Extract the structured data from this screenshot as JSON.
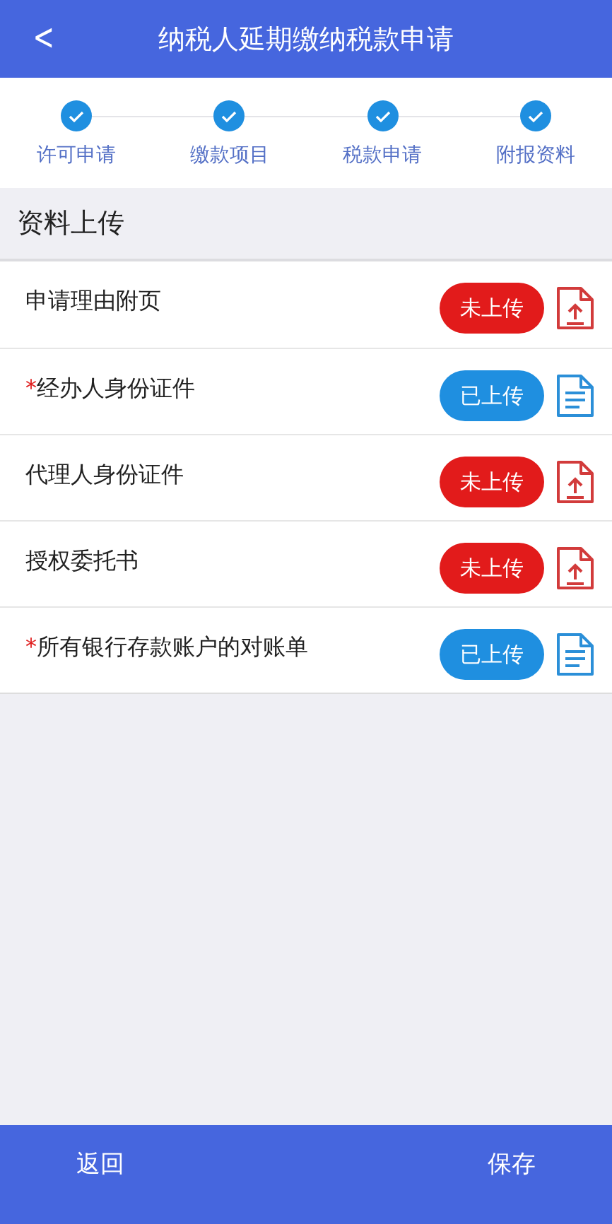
{
  "header": {
    "back": "<",
    "title": "纳税人延期缴纳税款申请"
  },
  "steps": [
    {
      "label": "许可申请",
      "done": true
    },
    {
      "label": "缴款项目",
      "done": true
    },
    {
      "label": "税款申请",
      "done": true
    },
    {
      "label": "附报资料",
      "done": true
    }
  ],
  "section": {
    "title": "资料上传"
  },
  "documents": [
    {
      "name": "申请理由附页",
      "required": false,
      "uploaded": false,
      "status": "未上传"
    },
    {
      "name": "经办人身份证件",
      "required": true,
      "uploaded": true,
      "status": "已上传"
    },
    {
      "name": "代理人身份证件",
      "required": false,
      "uploaded": false,
      "status": "未上传"
    },
    {
      "name": "授权委托书",
      "required": false,
      "uploaded": false,
      "status": "未上传"
    },
    {
      "name": "所有银行存款账户的对账单",
      "required": true,
      "uploaded": true,
      "status": "已上传"
    }
  ],
  "required_mark": "*",
  "footer": {
    "buttons": [
      "返回",
      "保存"
    ]
  }
}
